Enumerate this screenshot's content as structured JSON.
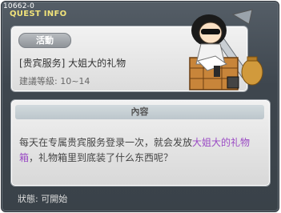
{
  "header": {
    "quest_id": "10662-0",
    "window_title": "QUEST INFO"
  },
  "quest": {
    "category": "活動",
    "name": "[贵宾服务] 大姐大的礼物",
    "level": "建議等級: 10~14"
  },
  "content": {
    "header": "內容",
    "text_before": "每天在专属贵宾服务登录一次，就会发放",
    "highlight": "大姐大的礼物箱",
    "text_after": "，礼物箱里到底装了什么东西呢？"
  },
  "footer": {
    "status": "狀態:  可開始"
  },
  "colors": {
    "title": "#f1e37a",
    "highlight": "#9a4ac4"
  }
}
